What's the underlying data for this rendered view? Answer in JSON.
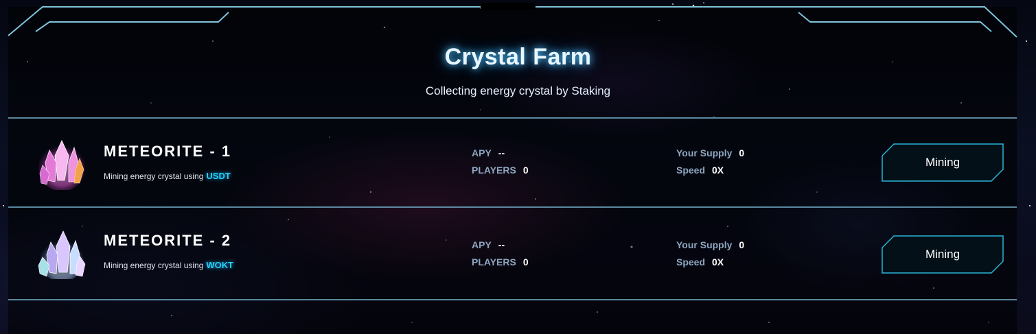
{
  "header": {
    "title": "Crystal Farm",
    "subtitle": "Collecting energy crystal by Staking"
  },
  "pools": [
    {
      "name": "METEORITE - 1",
      "description": "Mining energy crystal using",
      "token": "USDT",
      "crystal_color": "#e05bd0",
      "apy_label": "APY",
      "apy_value": "--",
      "players_label": "PLAYERS",
      "players_value": "0",
      "supply_label": "Your Supply",
      "supply_value": "0",
      "speed_label": "Speed",
      "speed_value": "0X",
      "action_label": "Mining"
    },
    {
      "name": "METEORITE - 2",
      "description": "Mining energy crystal using",
      "token": "WOKT",
      "crystal_color": "#b7d6ff",
      "apy_label": "APY",
      "apy_value": "--",
      "players_label": "PLAYERS",
      "players_value": "0",
      "supply_label": "Your Supply",
      "supply_value": "0",
      "speed_label": "Speed",
      "speed_value": "0X",
      "action_label": "Mining"
    }
  ],
  "colors": {
    "accent": "#21d4ff",
    "frame": "#7fc4dc",
    "button_border": "#2ab4d8"
  }
}
